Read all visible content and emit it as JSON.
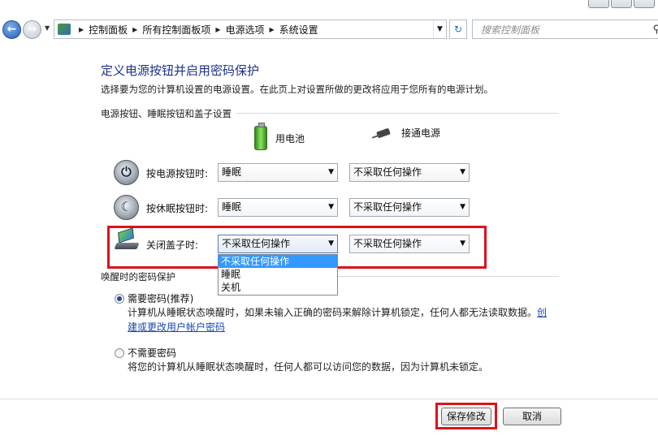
{
  "address_bar": {
    "breadcrumbs": [
      "控制面板",
      "所有控制面板项",
      "电源选项",
      "系统设置"
    ],
    "search_placeholder": "搜索控制面板"
  },
  "page": {
    "title": "定义电源按钮并启用密码保护",
    "description": "选择要为您的计算机设置的电源设置。在此页上对设置所做的更改将应用于您所有的电源计划。"
  },
  "power_section": {
    "title": "电源按钮、睡眠按钮和盖子设置",
    "columns": [
      "用电池",
      "接通电源"
    ],
    "rows": [
      {
        "label": "按电源按钮时:",
        "battery": "睡眠",
        "plugged": "不采取任何操作"
      },
      {
        "label": "按休眠按钮时:",
        "battery": "睡眠",
        "plugged": "不采取任何操作"
      },
      {
        "label": "关闭盖子时:",
        "battery": "不采取任何操作",
        "plugged": "不采取任何操作"
      }
    ],
    "open_dropdown_options": [
      "不采取任何操作",
      "睡眠",
      "关机"
    ],
    "open_dropdown_selected_index": 0
  },
  "password_section": {
    "title": "唤醒时的密码保护",
    "options": [
      {
        "label": "需要密码(推荐)",
        "checked": true,
        "desc_line1": "计算机从睡眠状态唤醒时，如果未输入正确的密码来解除计算机锁定，任何人都无法读取数据。",
        "link_part1": "创",
        "link_part2": "建或更改用户帐户密码"
      },
      {
        "label": "不需要密码",
        "checked": false,
        "desc_line1": "将您的计算机从睡眠状态唤醒时，任何人都可以访问您的数据，因为计算机未锁定。"
      }
    ]
  },
  "buttons": {
    "save": "保存修改",
    "cancel": "取消"
  },
  "colors": {
    "title_blue": "#1e3287",
    "highlight_red": "#e0111a",
    "selection_blue": "#3399ff",
    "link_blue": "#1b48b4"
  }
}
